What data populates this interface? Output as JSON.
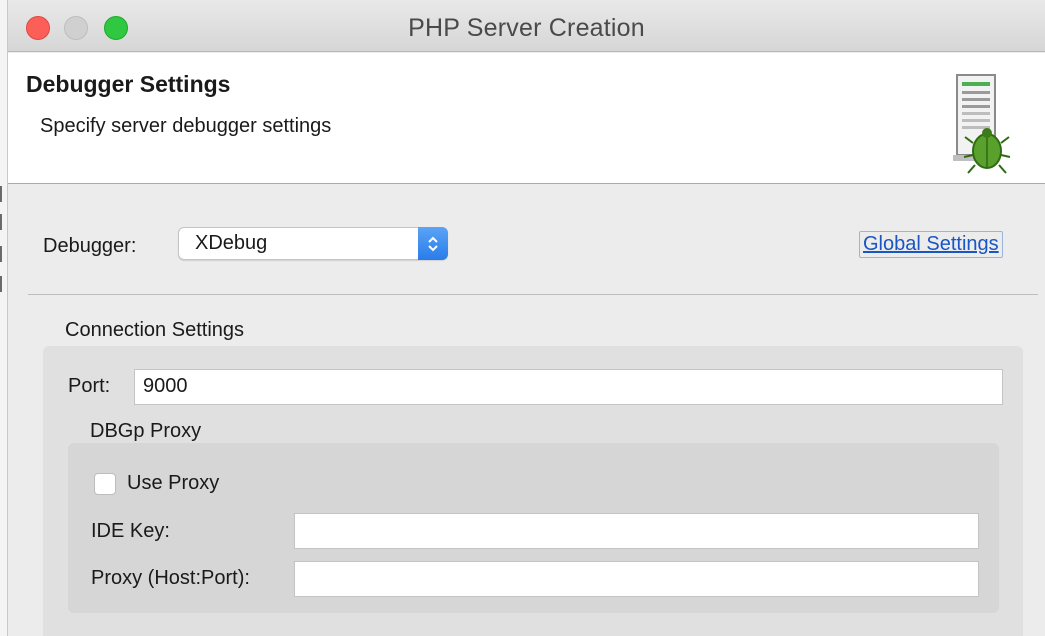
{
  "window": {
    "title": "PHP Server Creation"
  },
  "banner": {
    "title": "Debugger Settings",
    "description": "Specify server debugger settings",
    "icon": "server-bug-icon"
  },
  "debugger": {
    "label": "Debugger:",
    "selected": "XDebug"
  },
  "global_settings_link": "Global Settings",
  "connection": {
    "title": "Connection Settings",
    "port_label": "Port:",
    "port_value": "9000",
    "proxy": {
      "title": "DBGp Proxy",
      "use_proxy_label": "Use Proxy",
      "use_proxy_checked": false,
      "ide_key_label": "IDE Key:",
      "ide_key_value": "",
      "host_port_label": "Proxy (Host:Port):",
      "host_port_value": ""
    }
  },
  "colors": {
    "close": "#fc5f57",
    "zoom": "#2fc840",
    "link": "#1a55c4",
    "select_accent": "#2a7ce9"
  }
}
